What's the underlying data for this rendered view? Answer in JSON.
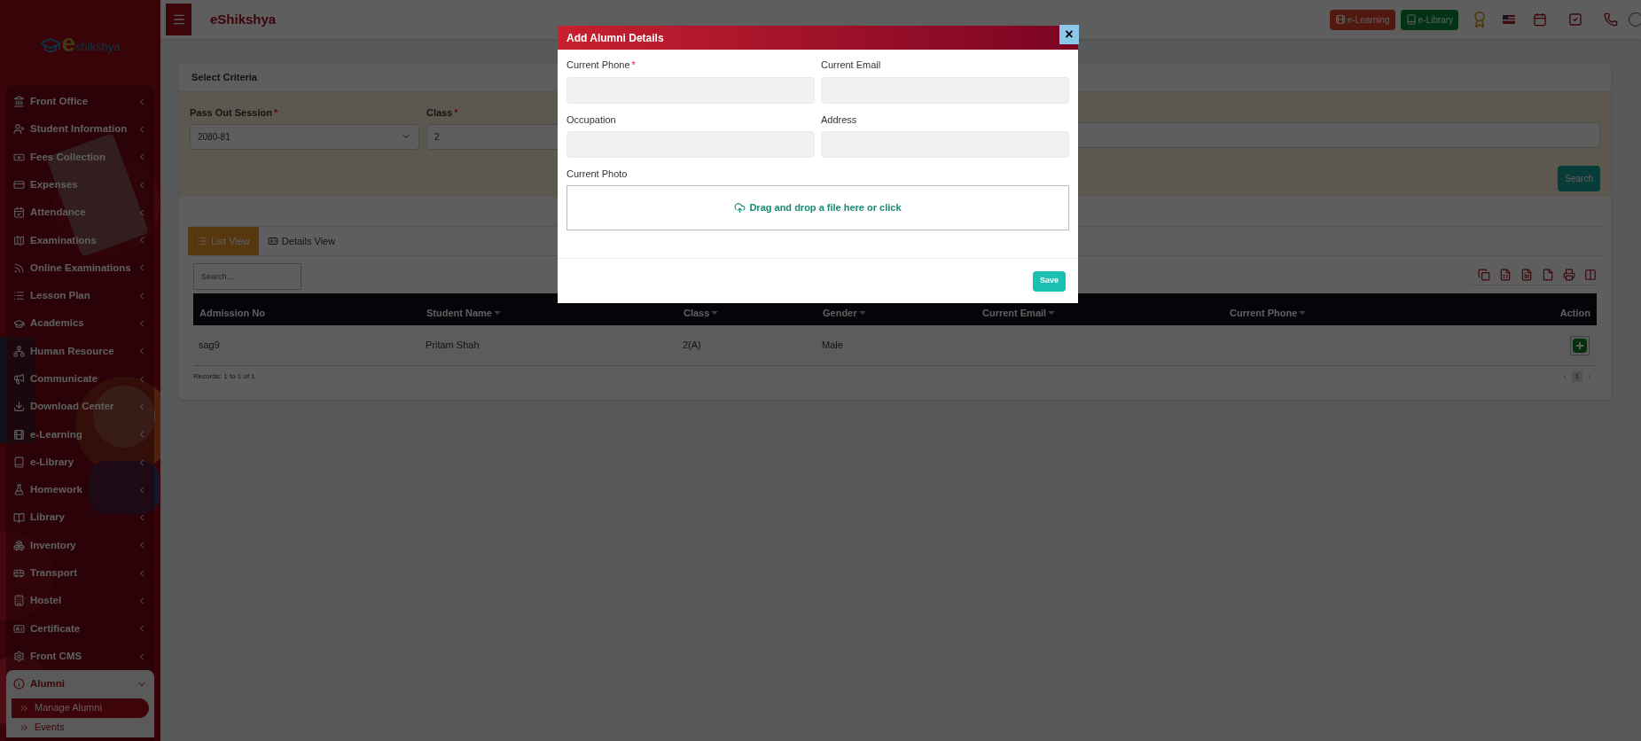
{
  "topbar": {
    "brand": "eShikshya",
    "logo_mark": "e",
    "logo_text": "shikshya",
    "buttons": [
      {
        "label": "e-Learning",
        "kind": "learning"
      },
      {
        "label": "e-Library",
        "kind": "library"
      }
    ]
  },
  "sidebar": {
    "items": [
      {
        "label": "Front Office",
        "expanded": false
      },
      {
        "label": "Student Information",
        "expanded": false
      },
      {
        "label": "Fees Collection",
        "expanded": false
      },
      {
        "label": "Expenses",
        "expanded": false
      },
      {
        "label": "Attendance",
        "expanded": false
      },
      {
        "label": "Examinations",
        "expanded": false
      },
      {
        "label": "Online Examinations",
        "expanded": false
      },
      {
        "label": "Lesson Plan",
        "expanded": false
      },
      {
        "label": "Academics",
        "expanded": false
      },
      {
        "label": "Human Resource",
        "expanded": false
      },
      {
        "label": "Communicate",
        "expanded": false
      },
      {
        "label": "Download Center",
        "expanded": false
      },
      {
        "label": "e-Learning",
        "expanded": false
      },
      {
        "label": "e-Library",
        "expanded": false
      },
      {
        "label": "Homework",
        "expanded": false
      },
      {
        "label": "Library",
        "expanded": false
      },
      {
        "label": "Inventory",
        "expanded": false
      },
      {
        "label": "Transport",
        "expanded": false
      },
      {
        "label": "Hostel",
        "expanded": false
      },
      {
        "label": "Certificate",
        "expanded": false
      },
      {
        "label": "Front CMS",
        "expanded": false
      },
      {
        "label": "Alumni",
        "expanded": true,
        "children": [
          {
            "label": "Manage Alumni",
            "selected": true
          },
          {
            "label": "Events",
            "selected": false
          }
        ]
      }
    ]
  },
  "criteria": {
    "title": "Select Criteria",
    "fields": [
      {
        "label": "Pass Out Session",
        "required_mark": "*",
        "value": "2080-81",
        "kind": "select"
      },
      {
        "label": "Class",
        "required_mark": "*",
        "value": "2",
        "kind": "select"
      }
    ],
    "search_button": "Search"
  },
  "tabs": [
    {
      "label": "List View",
      "selected": true
    },
    {
      "label": "Details View",
      "selected": false
    }
  ],
  "table": {
    "search_placeholder": "Search...",
    "columns": [
      {
        "label": "Admission No",
        "sortable": false
      },
      {
        "label": "Student Name",
        "sortable": true
      },
      {
        "label": "Class",
        "sortable": true
      },
      {
        "label": "Gender",
        "sortable": true
      },
      {
        "label": "Current Email",
        "sortable": true
      },
      {
        "label": "Current Phone",
        "sortable": true
      },
      {
        "label": "Action",
        "sortable": false
      }
    ],
    "rows": [
      {
        "cells": [
          "sag9",
          "Pritam Shah",
          "2(A)",
          "Male",
          "",
          ""
        ]
      }
    ],
    "footer": "Records: 1 to 1 of 1",
    "page": "1"
  },
  "modal": {
    "title": "Add Alumni Details",
    "close": "×",
    "fields": [
      {
        "label": "Current Phone",
        "required_mark": "*"
      },
      {
        "label": "Current Email"
      },
      {
        "label": "Occupation"
      },
      {
        "label": "Address"
      }
    ],
    "photo_label": "Current Photo",
    "dropzone": "Drag and drop a file here or click",
    "save_button": "Save"
  }
}
